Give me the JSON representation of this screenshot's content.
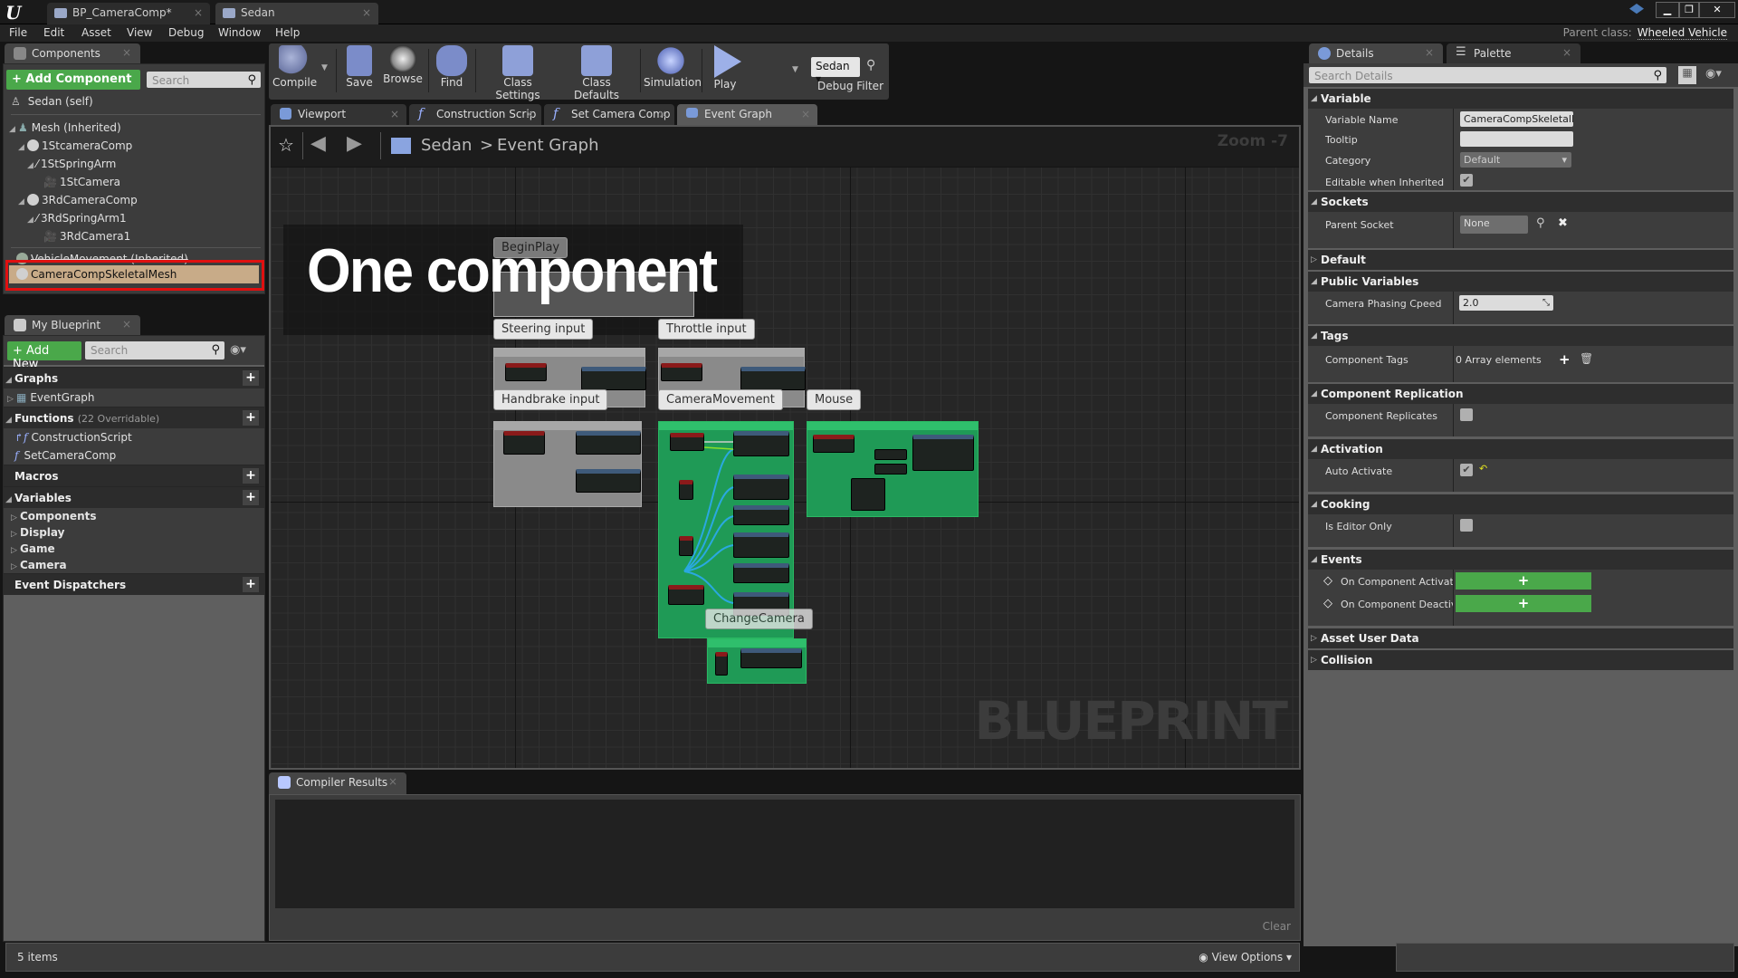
{
  "titlebar": {
    "tabs": [
      {
        "label": "BP_CameraComp*",
        "active": false
      },
      {
        "label": "Sedan",
        "active": true
      }
    ],
    "window_buttons": [
      "minimize",
      "restore",
      "close"
    ]
  },
  "menubar": {
    "items": [
      "File",
      "Edit",
      "Asset",
      "View",
      "Debug",
      "Window",
      "Help"
    ],
    "parent_class_label": "Parent class:",
    "parent_class_value": "Wheeled Vehicle"
  },
  "components_panel": {
    "tab_label": "Components",
    "add_button": "+ Add Component",
    "search_placeholder": "Search",
    "self_item": "Sedan (self)",
    "tree": [
      {
        "label": "Mesh (Inherited)",
        "level": 0
      },
      {
        "label": "1StcameraComp",
        "level": 1
      },
      {
        "label": "1StSpringArm",
        "level": 2
      },
      {
        "label": "1StCamera",
        "level": 3
      },
      {
        "label": "3RdCameraComp",
        "level": 1
      },
      {
        "label": "3RdSpringArm1",
        "level": 2
      },
      {
        "label": "3RdCamera1",
        "level": 3
      }
    ],
    "vehicle_movement": "VehicleMovement (Inherited)",
    "selected_item": "CameraCompSkeletalMesh",
    "highlight_color": "#e01010",
    "selected_bg": "#c8ab88"
  },
  "my_blueprint": {
    "tab_label": "My Blueprint",
    "add_button": "+ Add New",
    "search_placeholder": "Search",
    "graphs_label": "Graphs",
    "graph_items": [
      "EventGraph"
    ],
    "functions_label": "Functions",
    "functions_count": "(22 Overridable)",
    "function_items": [
      "ConstructionScript",
      "SetCameraComp"
    ],
    "macros_label": "Macros",
    "variables_label": "Variables",
    "variable_categories": [
      "Components",
      "Display",
      "Game",
      "Camera"
    ],
    "dispatchers_label": "Event Dispatchers"
  },
  "toolbar": {
    "buttons": [
      "Compile",
      "Save",
      "Browse",
      "Find",
      "Class Settings",
      "Class Defaults",
      "Simulation",
      "Play"
    ],
    "debug_object": "Sedan",
    "debug_filter_label": "Debug Filter"
  },
  "doc_tabs": [
    {
      "label": "Viewport"
    },
    {
      "label": "Construction Scrip"
    },
    {
      "label": "Set Camera Comp"
    },
    {
      "label": "Event Graph",
      "active": true
    }
  ],
  "graph": {
    "breadcrumb_root": "Sedan",
    "breadcrumb_separator": ">",
    "breadcrumb_current": "Event Graph",
    "zoom_label": "Zoom -7",
    "watermark": "BLUEPRINT",
    "overlay_title": "One component",
    "comments": [
      "BeginPlay",
      "Steering input",
      "Throttle input",
      "Handbrake input",
      "CameraMovement",
      "Mouse",
      "ChangeCamera"
    ],
    "comment_green": "#1f9a56"
  },
  "compiler": {
    "tab_label": "Compiler Results",
    "clear_label": "Clear"
  },
  "status": {
    "items_count": "5 items",
    "view_options": "View Options"
  },
  "details": {
    "tab_label": "Details",
    "palette_tab": "Palette",
    "search_placeholder": "Search Details",
    "sections": {
      "variable": {
        "title": "Variable",
        "variable_name_label": "Variable Name",
        "variable_name_value": "CameraCompSkeletalM",
        "tooltip_label": "Tooltip",
        "tooltip_value": "",
        "category_label": "Category",
        "category_value": "Default",
        "editable_label": "Editable when Inherited",
        "editable_checked": true
      },
      "sockets": {
        "title": "Sockets",
        "parent_socket_label": "Parent Socket",
        "parent_socket_value": "None"
      },
      "default": {
        "title": "Default"
      },
      "public_variables": {
        "title": "Public Variables",
        "camera_speed_label": "Camera Phasing Cpeed",
        "camera_speed_value": "2.0"
      },
      "tags": {
        "title": "Tags",
        "component_tags_label": "Component Tags",
        "component_tags_value": "0 Array elements"
      },
      "replication": {
        "title": "Component Replication",
        "replicates_label": "Component Replicates",
        "replicates_checked": false
      },
      "activation": {
        "title": "Activation",
        "auto_activate_label": "Auto Activate",
        "auto_activate_checked": true
      },
      "cooking": {
        "title": "Cooking",
        "editor_only_label": "Is Editor Only",
        "editor_only_checked": false
      },
      "events": {
        "title": "Events",
        "activated_label": "On Component Activated",
        "deactivated_label": "On Component Deactiva"
      },
      "asset_user_data": {
        "title": "Asset User Data"
      },
      "collision": {
        "title": "Collision"
      }
    }
  }
}
